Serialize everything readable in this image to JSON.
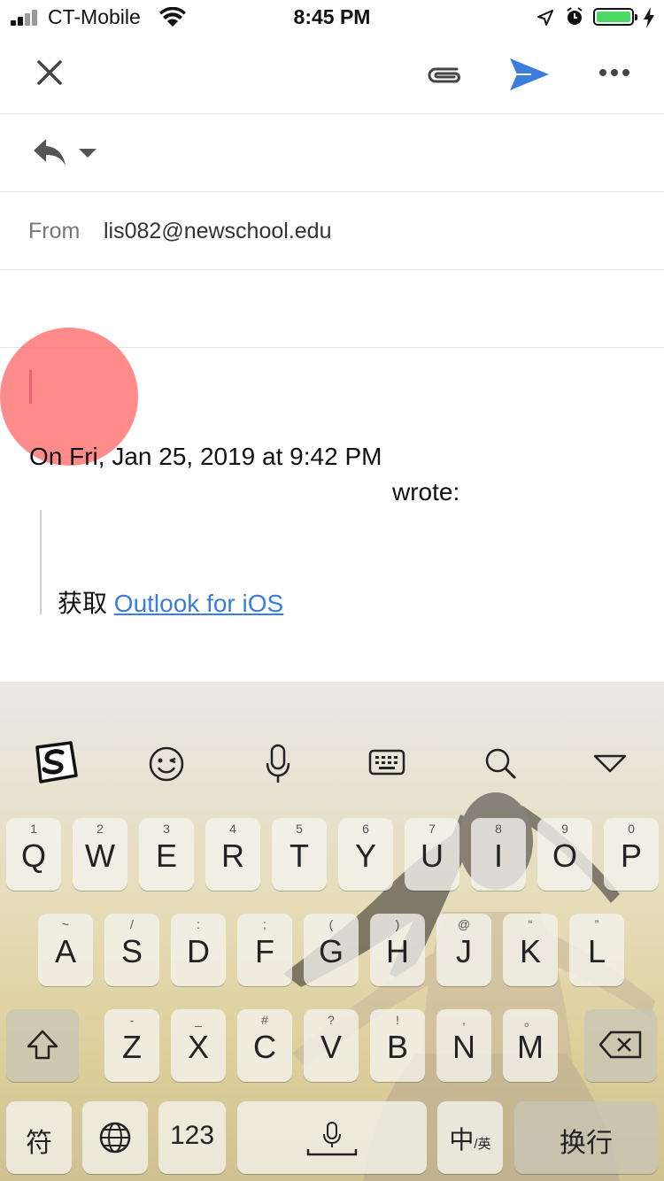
{
  "status_bar": {
    "carrier": "CT-Mobile",
    "time": "8:45 PM",
    "battery_color": "#4cd964"
  },
  "toolbar": {
    "close_icon": "close-icon",
    "attach_icon": "paperclip-icon",
    "send_icon": "send-icon",
    "more_icon": "more-icon",
    "accent": "#3b7ddd"
  },
  "compose": {
    "from_label": "From",
    "from_value": "lis082@newschool.edu",
    "quote_header_line1": "On Fri, Jan 25, 2019 at 9:42 PM",
    "quote_header_line2": "wrote:",
    "signature_prefix": "获取",
    "signature_link": "Outlook for iOS"
  },
  "keyboard": {
    "row1": [
      {
        "sub": "1",
        "key": "Q"
      },
      {
        "sub": "2",
        "key": "W"
      },
      {
        "sub": "3",
        "key": "E"
      },
      {
        "sub": "4",
        "key": "R"
      },
      {
        "sub": "5",
        "key": "T"
      },
      {
        "sub": "6",
        "key": "Y"
      },
      {
        "sub": "7",
        "key": "U"
      },
      {
        "sub": "8",
        "key": "I"
      },
      {
        "sub": "9",
        "key": "O"
      },
      {
        "sub": "0",
        "key": "P"
      }
    ],
    "row2": [
      {
        "sub": "~",
        "key": "A"
      },
      {
        "sub": "/",
        "key": "S"
      },
      {
        "sub": ":",
        "key": "D"
      },
      {
        "sub": ";",
        "key": "F"
      },
      {
        "sub": "(",
        "key": "G"
      },
      {
        "sub": ")",
        "key": "H"
      },
      {
        "sub": "@",
        "key": "J"
      },
      {
        "sub": "“",
        "key": "K"
      },
      {
        "sub": "”",
        "key": "L"
      }
    ],
    "row3": [
      {
        "sub": "-",
        "key": "Z"
      },
      {
        "sub": "_",
        "key": "X"
      },
      {
        "sub": "#",
        "key": "C"
      },
      {
        "sub": "?",
        "key": "V"
      },
      {
        "sub": "!",
        "key": "B"
      },
      {
        "sub": ",",
        "key": "N"
      },
      {
        "sub": "。",
        "key": "M"
      }
    ],
    "bottom": {
      "symbols": "符",
      "numbers": "123",
      "lang": "中",
      "lang_sub": "/英",
      "return": "换行"
    }
  }
}
